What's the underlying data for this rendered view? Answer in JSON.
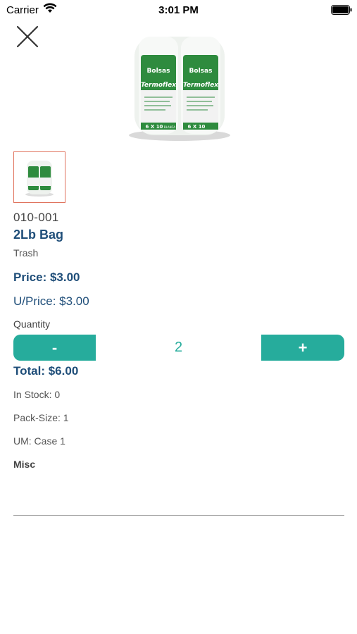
{
  "status_bar": {
    "carrier": "Carrier",
    "time": "3:01 PM"
  },
  "product": {
    "image_text": {
      "brand": "Bolsas",
      "line": "Termoflex",
      "size": "6 X 10",
      "variant": "BLANCA"
    },
    "sku": "010-001",
    "name": "2Lb Bag",
    "category": "Trash",
    "price": "Price: $3.00",
    "unit_price": "U/Price: $3.00",
    "quantity_label": "Quantity",
    "quantity": "2",
    "minus_label": "-",
    "plus_label": "+",
    "total": "Total: $6.00",
    "in_stock": "In Stock: 0",
    "pack_size": "Pack-Size: 1",
    "um": "UM: Case 1",
    "misc_label": "Misc"
  },
  "colors": {
    "accent": "#26ac9c",
    "navy": "#1f4e79",
    "thumb_border": "#e0735d"
  }
}
